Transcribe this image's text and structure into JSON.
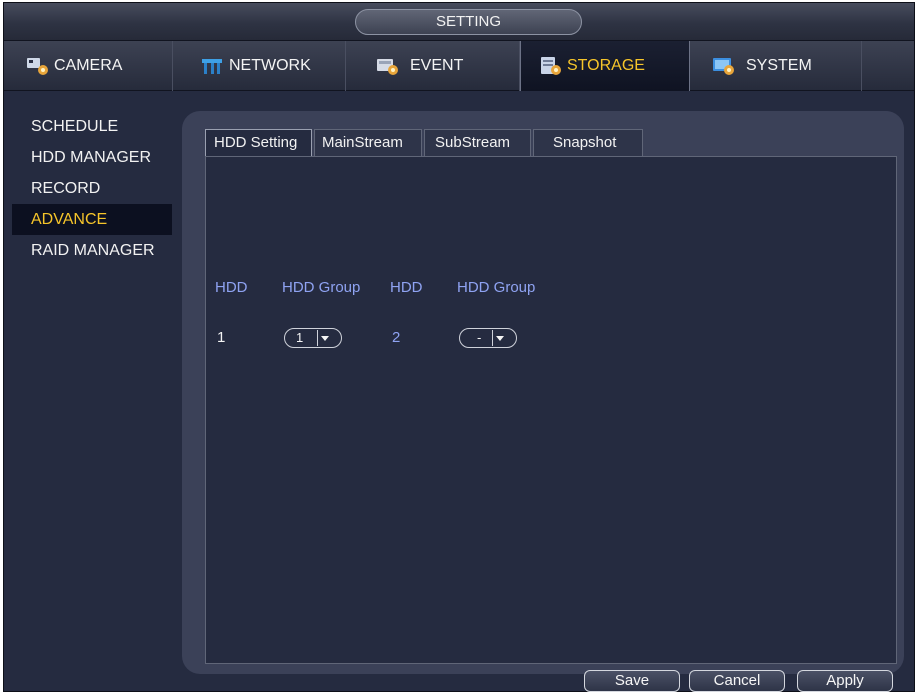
{
  "window": {
    "title": "SETTING"
  },
  "nav": {
    "tabs": [
      {
        "label": "CAMERA",
        "icon": "camera-icon"
      },
      {
        "label": "NETWORK",
        "icon": "network-icon"
      },
      {
        "label": "EVENT",
        "icon": "event-icon"
      },
      {
        "label": "STORAGE",
        "icon": "storage-icon",
        "active": true
      },
      {
        "label": "SYSTEM",
        "icon": "system-icon"
      }
    ]
  },
  "sidebar": {
    "items": [
      {
        "label": "SCHEDULE"
      },
      {
        "label": "HDD MANAGER"
      },
      {
        "label": "RECORD"
      },
      {
        "label": "ADVANCE",
        "active": true
      },
      {
        "label": "RAID MANAGER"
      }
    ]
  },
  "subtabs": [
    {
      "label": "HDD Setting",
      "active": true
    },
    {
      "label": "MainStream"
    },
    {
      "label": "SubStream"
    },
    {
      "label": "Snapshot"
    }
  ],
  "table": {
    "headers": [
      "HDD",
      "HDD Group",
      "HDD",
      "HDD Group"
    ],
    "row": {
      "hdd1": "1",
      "group1": "1",
      "hdd2": "2",
      "group2": "-"
    }
  },
  "buttons": {
    "save": "Save",
    "cancel": "Cancel",
    "apply": "Apply"
  },
  "colors": {
    "accent": "#f6c52a",
    "header_text": "#8fa3f2",
    "background": "#252b40",
    "panel": "#3b4158"
  }
}
